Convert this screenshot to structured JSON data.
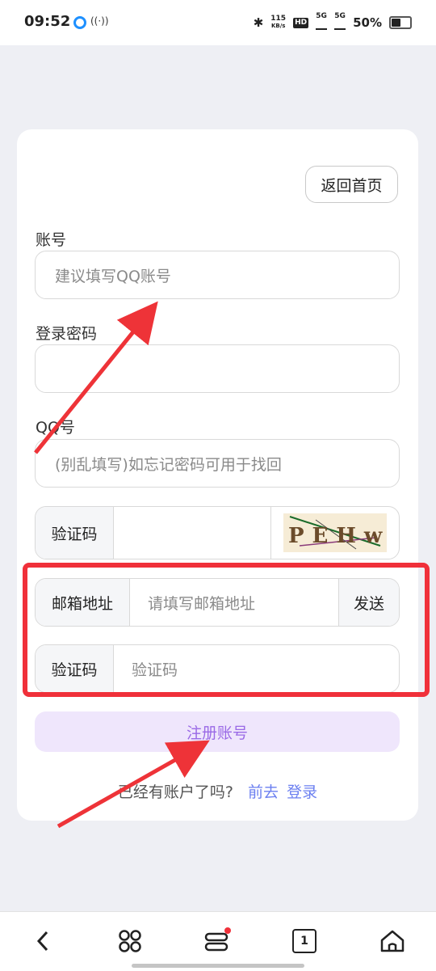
{
  "status_bar": {
    "time": "09:52",
    "speed_value": "115",
    "speed_unit": "KB/s",
    "hd_label": "HD",
    "network_1": "5G",
    "network_2": "5G",
    "battery": "50%"
  },
  "form": {
    "back_button": "返回首页",
    "account_label": "账号",
    "account_placeholder": "建议填写QQ账号",
    "password_label": "登录密码",
    "password_placeholder": "",
    "qq_label": "QQ号",
    "qq_placeholder": "(别乱填写)如忘记密码可用于找回",
    "captcha_label": "验证码",
    "captcha_text": "PEHw",
    "email_label": "邮箱地址",
    "email_placeholder": "请填写邮箱地址",
    "send_button": "发送",
    "email_code_label": "验证码",
    "email_code_placeholder": "验证码",
    "register_button": "注册账号",
    "footer_text": "已经有账户了吗?",
    "footer_link_1": "前去",
    "footer_link_2": "登录"
  },
  "colors": {
    "accent": "#9a6ae6",
    "accent_bg": "#efe6fc",
    "link": "#6b7ff0",
    "highlight_red": "#f0303a"
  },
  "nav_bar": {
    "back_icon": "chevron-left-icon",
    "apps_icon": "cloverleaf-icon",
    "menu_icon": "menu-bars-icon",
    "tabs_icon": "tabs-icon",
    "tabs_count": "1",
    "home_icon": "home-icon"
  }
}
